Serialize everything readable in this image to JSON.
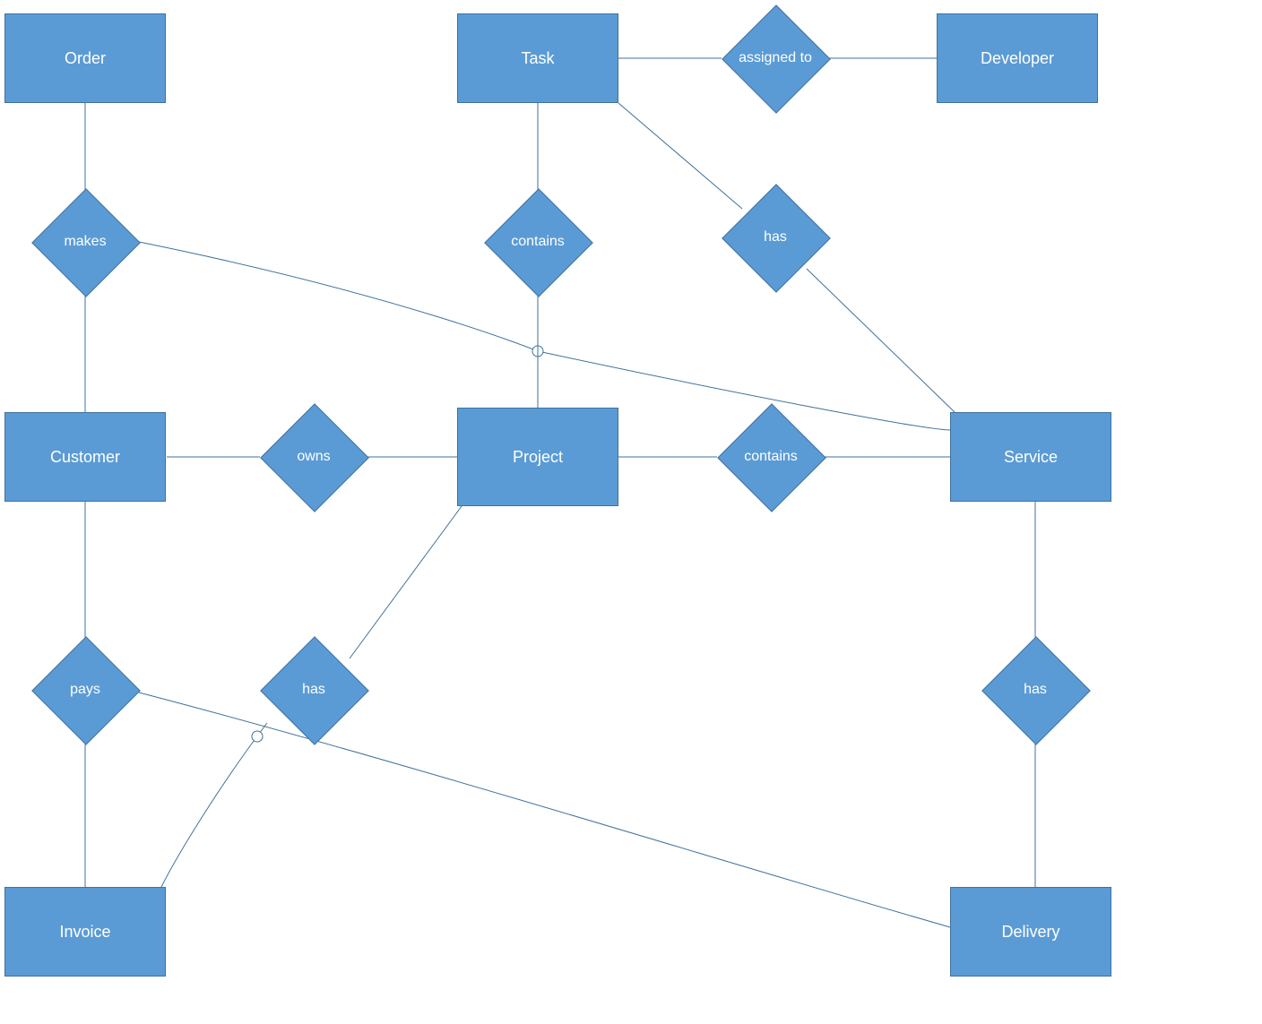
{
  "diagram": {
    "type": "entity-relationship",
    "colors": {
      "fill": "#5b9bd5",
      "border": "#41719c",
      "text": "#ffffff",
      "line": "#41719c"
    },
    "entities": {
      "order": {
        "label": "Order"
      },
      "task": {
        "label": "Task"
      },
      "developer": {
        "label": "Developer"
      },
      "customer": {
        "label": "Customer"
      },
      "project": {
        "label": "Project"
      },
      "service": {
        "label": "Service"
      },
      "invoice": {
        "label": "Invoice"
      },
      "delivery": {
        "label": "Delivery"
      }
    },
    "relationships": {
      "assigned_to": {
        "label": "assigned to",
        "between": [
          "task",
          "developer"
        ]
      },
      "makes": {
        "label": "makes",
        "between": [
          "order",
          "customer"
        ],
        "extra_link_to": "service"
      },
      "contains_task": {
        "label": "contains",
        "between": [
          "task",
          "project"
        ]
      },
      "has_task": {
        "label": "has",
        "between": [
          "task",
          "service"
        ]
      },
      "owns": {
        "label": "owns",
        "between": [
          "customer",
          "project"
        ]
      },
      "contains_service": {
        "label": "contains",
        "between": [
          "project",
          "service"
        ]
      },
      "pays": {
        "label": "pays",
        "between": [
          "customer",
          "invoice"
        ],
        "extra_link_to": "delivery"
      },
      "has_project": {
        "label": "has",
        "between": [
          "project",
          "invoice"
        ]
      },
      "has_service": {
        "label": "has",
        "between": [
          "service",
          "delivery"
        ]
      }
    }
  }
}
